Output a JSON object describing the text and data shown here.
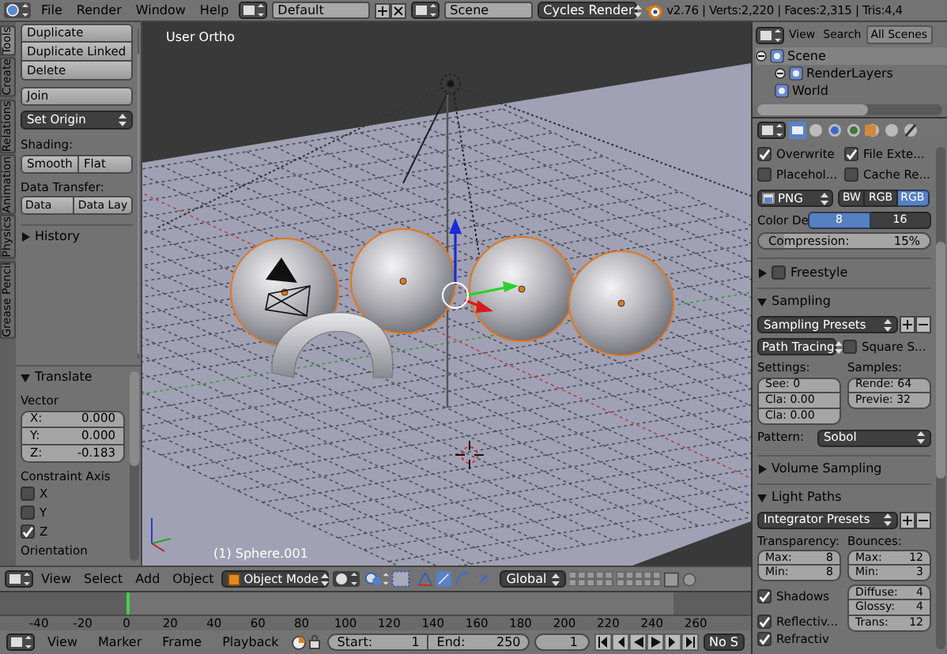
{
  "top_bar": {
    "menus": [
      "File",
      "Render",
      "Window",
      "Help"
    ],
    "layout": "Default",
    "scene": "Scene",
    "engine": "Cycles Render",
    "stats": "v2.76 | Verts:2,220 | Faces:2,315 | Tris:4,4"
  },
  "tool_tabs": [
    {
      "label": "Tools",
      "selected": true
    },
    {
      "label": "Create",
      "selected": false
    },
    {
      "label": "Relations",
      "selected": false
    },
    {
      "label": "Animation",
      "selected": false
    },
    {
      "label": "Physics",
      "selected": false
    },
    {
      "label": "Grease Pencil",
      "selected": false
    }
  ],
  "tools": {
    "edit_buttons": [
      "Duplicate",
      "Duplicate Linked",
      "Delete"
    ],
    "join": "Join",
    "set_origin": "Set Origin",
    "shading_label": "Shading:",
    "shading_buttons": [
      "Smooth",
      "Flat"
    ],
    "data_transfer_label": "Data Transfer:",
    "data_transfer_buttons": [
      "Data",
      "Data Lay"
    ],
    "history": {
      "label": "History",
      "expanded": false
    }
  },
  "translate": {
    "title": "Translate",
    "expanded": true,
    "vector_label": "Vector",
    "vector": [
      {
        "axis": "X:",
        "value": "0.000"
      },
      {
        "axis": "Y:",
        "value": "0.000"
      },
      {
        "axis": "Z:",
        "value": "-0.183"
      }
    ],
    "constraint_label": "Constraint Axis",
    "constraints": [
      {
        "label": "X",
        "checked": false
      },
      {
        "label": "Y",
        "checked": false
      },
      {
        "label": "Z",
        "checked": true
      }
    ],
    "orientation_label": "Orientation"
  },
  "viewport": {
    "view_label": "User Ortho",
    "object_label": "(1) Sphere.001"
  },
  "outliner": {
    "menus": [
      "View",
      "Search"
    ],
    "filter": "All Scenes",
    "tree": [
      {
        "label": "Scene",
        "expanded": true,
        "children": [
          {
            "label": "RenderLayers",
            "expanded": true
          },
          {
            "label": "World"
          }
        ]
      }
    ]
  },
  "properties": {
    "output_checks": [
      {
        "label": "Overwrite",
        "checked": true
      },
      {
        "label": "File Exte...",
        "checked": true
      },
      {
        "label": "Placehol...",
        "checked": false
      },
      {
        "label": "Cache Re...",
        "checked": false
      }
    ],
    "format": "PNG",
    "color_modes": [
      {
        "label": "BW",
        "selected": false
      },
      {
        "label": "RGB",
        "selected": false
      },
      {
        "label": "RGB",
        "selected": true
      }
    ],
    "color_depth": {
      "label": "Color De",
      "options": [
        {
          "label": "8",
          "selected": true
        },
        {
          "label": "16",
          "selected": false
        }
      ]
    },
    "compression": {
      "label": "Compression:",
      "value": "15%",
      "level": 0.15
    },
    "freestyle": {
      "label": "Freestyle",
      "expanded": false,
      "checked": false
    },
    "sampling": {
      "label": "Sampling",
      "expanded": true,
      "presets": "Sampling Presets",
      "integrator": "Path Tracing",
      "square": {
        "label": "Square S...",
        "checked": false
      },
      "settings_label": "Settings:",
      "settings": [
        "See: 0",
        "Cla:  0.00",
        "Cla:  0.00"
      ],
      "samples_label": "Samples:",
      "samples": [
        "Rende: 64",
        "Previe: 32"
      ],
      "pattern_label": "Pattern:",
      "pattern": "Sobol"
    },
    "volume_sampling": {
      "label": "Volume Sampling",
      "expanded": false
    },
    "light_paths": {
      "label": "Light Paths",
      "expanded": true,
      "presets": "Integrator Presets",
      "transparency_label": "Transparency:",
      "transparency": [
        {
          "label": "Max:",
          "value": "8"
        },
        {
          "label": "Min:",
          "value": "8"
        }
      ],
      "bounces_label": "Bounces:",
      "bounces": [
        {
          "label": "Max:",
          "value": "12"
        },
        {
          "label": "Min:",
          "value": "3"
        }
      ],
      "bounce_types": [
        {
          "label": "Diffuse:",
          "value": "4"
        },
        {
          "label": "Glossy:",
          "value": "4"
        },
        {
          "label": "Trans:",
          "value": "12"
        }
      ],
      "checks": [
        {
          "label": "Shadows",
          "checked": true
        },
        {
          "label": "Reflectiv...",
          "checked": true
        },
        {
          "label": "Refractiv",
          "checked": true
        }
      ]
    }
  },
  "view3d_header": {
    "menus": [
      "View",
      "Select",
      "Add",
      "Object"
    ],
    "mode": "Object Mode",
    "orientation": "Global"
  },
  "timeline": {
    "ticks": [
      "-40",
      "-20",
      "0",
      "20",
      "40",
      "60",
      "80",
      "100",
      "120",
      "140",
      "160",
      "180",
      "200",
      "220",
      "240",
      "260"
    ],
    "menus": [
      "View",
      "Marker",
      "Frame",
      "Playback"
    ],
    "start": {
      "label": "Start:",
      "value": "1"
    },
    "end": {
      "label": "End:",
      "value": "250"
    },
    "current": "1",
    "sync": "No S"
  }
}
